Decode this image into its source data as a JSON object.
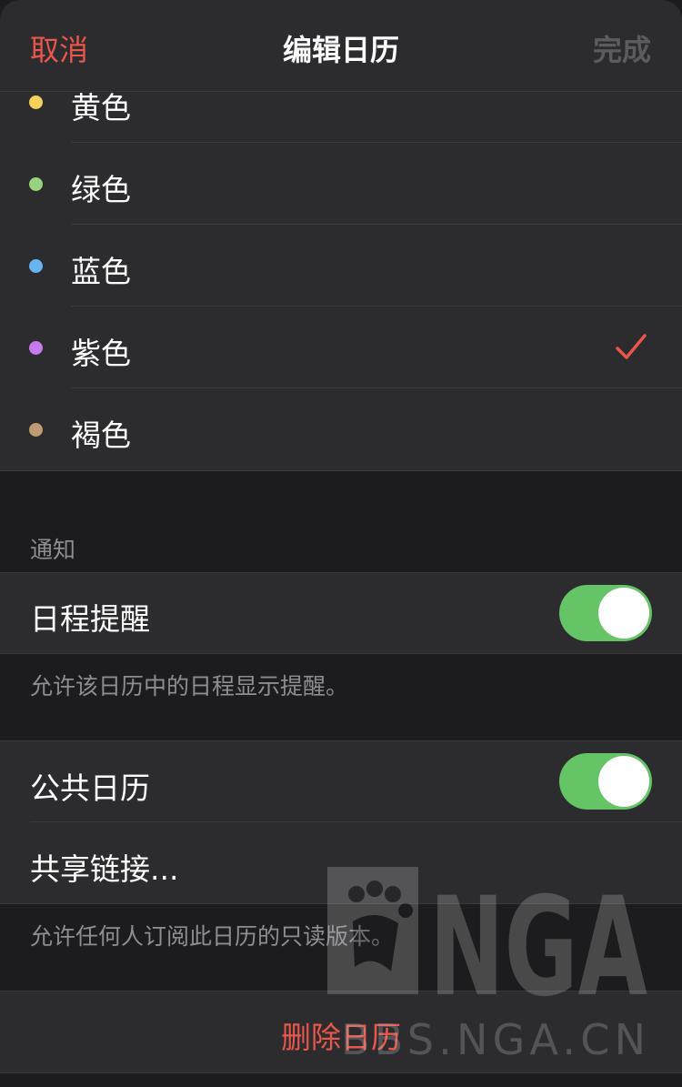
{
  "nav": {
    "cancel": "取消",
    "title": "编辑日历",
    "done": "完成"
  },
  "colors": [
    {
      "label": "黄色",
      "color": "#f5d15b",
      "selected": false
    },
    {
      "label": "绿色",
      "color": "#98d47d",
      "selected": false
    },
    {
      "label": "蓝色",
      "color": "#68b4f0",
      "selected": false
    },
    {
      "label": "紫色",
      "color": "#c67bed",
      "selected": true
    },
    {
      "label": "褐色",
      "color": "#bf9b74",
      "selected": false
    }
  ],
  "notifications": {
    "header": "通知",
    "event_alerts": {
      "label": "日程提醒",
      "on": true
    },
    "footer": "允许该日历中的日程显示提醒。"
  },
  "public": {
    "public_calendar": {
      "label": "公共日历",
      "on": true
    },
    "share_link": "共享链接...",
    "footer": "允许任何人订阅此日历的只读版本。"
  },
  "delete_label": "删除日历",
  "watermark": {
    "logo": "NGA",
    "url": "BBS.NGA.CN"
  },
  "accent": "#e9564b",
  "toggle_on_color": "#65c466"
}
